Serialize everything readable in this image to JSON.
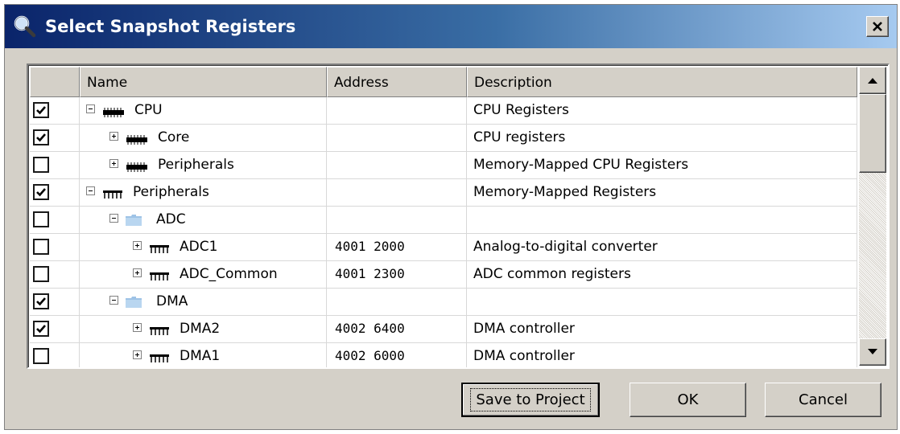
{
  "window": {
    "title": "Select Snapshot Registers",
    "close_label": "x",
    "icon": "magnifier-icon",
    "titlebar_colors": [
      "#0a246a",
      "#a6caf0"
    ]
  },
  "table": {
    "columns": [
      "",
      "Name",
      "Address",
      "Description"
    ],
    "rows": [
      {
        "checked": true,
        "expander": "minus",
        "depth": 0,
        "icon": "cpu-chip-icon",
        "name": "CPU",
        "address": "",
        "description": "CPU Registers"
      },
      {
        "checked": true,
        "expander": "plus",
        "depth": 1,
        "icon": "cpu-chip-icon",
        "name": "Core",
        "address": "",
        "description": "CPU registers"
      },
      {
        "checked": false,
        "expander": "plus",
        "depth": 1,
        "icon": "cpu-chip-icon",
        "name": "Peripherals",
        "address": "",
        "description": "Memory-Mapped CPU Registers"
      },
      {
        "checked": true,
        "expander": "minus",
        "depth": 0,
        "icon": "register-block-icon",
        "name": "Peripherals",
        "address": "",
        "description": "Memory-Mapped Registers"
      },
      {
        "checked": false,
        "expander": "minus",
        "depth": 1,
        "icon": "folder-icon",
        "name": "ADC",
        "address": "",
        "description": ""
      },
      {
        "checked": false,
        "expander": "plus",
        "depth": 2,
        "icon": "register-block-icon",
        "name": "ADC1",
        "address": "4001 2000",
        "description": "Analog-to-digital converter"
      },
      {
        "checked": false,
        "expander": "plus",
        "depth": 2,
        "icon": "register-block-icon",
        "name": "ADC_Common",
        "address": "4001 2300",
        "description": "ADC common registers"
      },
      {
        "checked": true,
        "expander": "minus",
        "depth": 1,
        "icon": "folder-icon",
        "name": "DMA",
        "address": "",
        "description": ""
      },
      {
        "checked": true,
        "expander": "plus",
        "depth": 2,
        "icon": "register-block-icon",
        "name": "DMA2",
        "address": "4002 6400",
        "description": "DMA controller"
      },
      {
        "checked": false,
        "expander": "plus",
        "depth": 2,
        "icon": "register-block-icon",
        "name": "DMA1",
        "address": "4002 6000",
        "description": "DMA controller"
      }
    ]
  },
  "scrollbar": {
    "up_icon": "scroll-up-arrow-icon",
    "down_icon": "scroll-down-arrow-icon"
  },
  "buttons": {
    "save": "Save to Project",
    "ok": "OK",
    "cancel": "Cancel"
  }
}
